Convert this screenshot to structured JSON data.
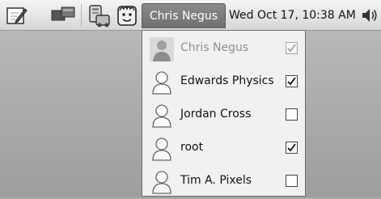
{
  "panel": {
    "user_button_label": "Chris Negus",
    "clock": "Wed Oct 17, 10:38 AM",
    "icons": [
      "text-editor-icon",
      "workspace-switcher-icon",
      "network-icon",
      "user-face-icon",
      "volume-icon"
    ]
  },
  "users_menu": {
    "items": [
      {
        "name": "Chris Negus",
        "checked": true,
        "disabled": true
      },
      {
        "name": "Edwards Physics",
        "checked": true,
        "disabled": false
      },
      {
        "name": "Jordan Cross",
        "checked": false,
        "disabled": false
      },
      {
        "name": "root",
        "checked": true,
        "disabled": false
      },
      {
        "name": "Tim A. Pixels",
        "checked": false,
        "disabled": false
      }
    ]
  }
}
